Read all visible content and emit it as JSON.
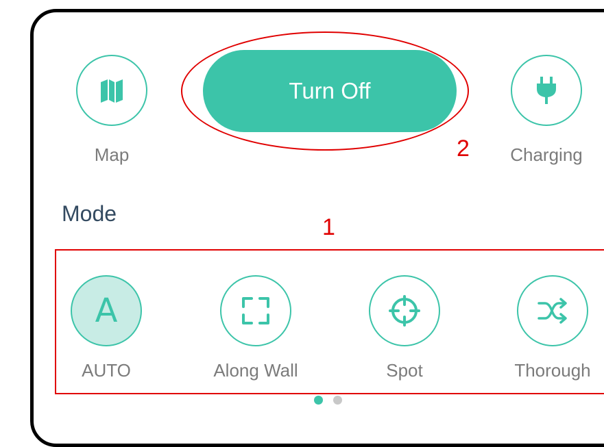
{
  "top_controls": {
    "map_label": "Map",
    "turn_off_label": "Turn Off",
    "charging_label": "Charging"
  },
  "mode": {
    "title": "Mode",
    "options": [
      {
        "label": "AUTO",
        "icon": "letter-a-icon",
        "glyph": "A",
        "selected": true
      },
      {
        "label": "Along Wall",
        "icon": "corners-frame-icon",
        "selected": false
      },
      {
        "label": "Spot",
        "icon": "crosshair-icon",
        "selected": false
      },
      {
        "label": "Thorough",
        "icon": "shuffle-icon",
        "selected": false
      }
    ]
  },
  "annotations": {
    "callout_1": "1",
    "callout_2": "2"
  },
  "pagination": {
    "total": 2,
    "active_index": 0
  },
  "colors": {
    "accent": "#3cc4a9",
    "accent_light": "#c8ece5",
    "annotation_red": "#e00000",
    "frame": "#000000",
    "label_gray": "#7b7b7b",
    "title_color": "#334a60"
  }
}
